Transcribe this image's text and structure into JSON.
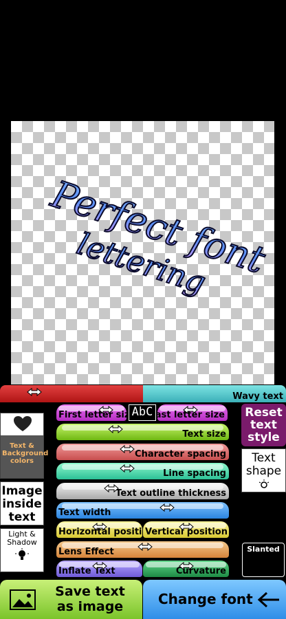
{
  "canvas": {
    "line1": "Perfect font",
    "line2": "lettering"
  },
  "wavy": {
    "label": "Wavy text"
  },
  "abc_badge": "AbC",
  "sliders": {
    "first_letter": "First letter size",
    "last_letter": "Last letter size",
    "text_size": "Text size",
    "char_spacing": "Character spacing",
    "line_spacing": "Line spacing",
    "outline": "Text outline thickness",
    "text_width": "Text width",
    "h_position": "Horizontal position",
    "v_position": "Vertical position",
    "lens": "Lens Effect",
    "inflate": "Inflate Text",
    "curvature": "Curvature"
  },
  "left_panel": {
    "colors": "Text & Background colors",
    "image_inside": "Image inside text",
    "light_shadow": "Light & Shadow"
  },
  "right_panel": {
    "reset": "Reset text style",
    "shape": "Text shape",
    "slanted": "Slanted"
  },
  "bottom": {
    "save": "Save text as image",
    "change_font": "Change font"
  },
  "colors": {
    "accent_purple": "#7a1b6b",
    "text_blue": "#4a9de8"
  }
}
